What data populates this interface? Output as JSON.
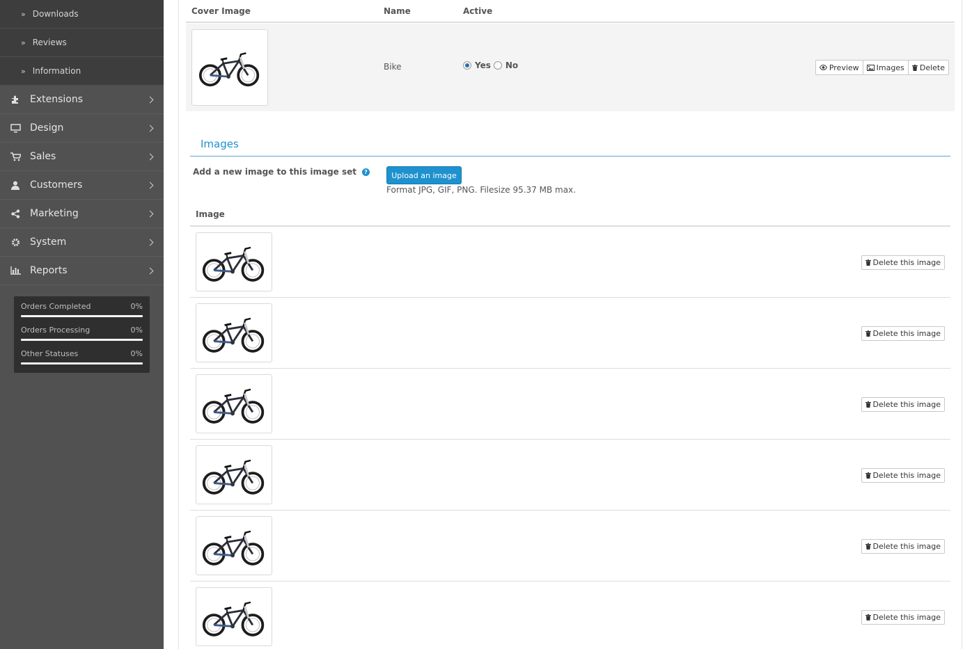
{
  "sidebar": {
    "sub_items": [
      {
        "label": "Downloads"
      },
      {
        "label": "Reviews"
      },
      {
        "label": "Information"
      }
    ],
    "menu": [
      {
        "label": "Extensions",
        "icon": "puzzle-icon"
      },
      {
        "label": "Design",
        "icon": "monitor-icon"
      },
      {
        "label": "Sales",
        "icon": "cart-icon"
      },
      {
        "label": "Customers",
        "icon": "user-icon"
      },
      {
        "label": "Marketing",
        "icon": "share-icon"
      },
      {
        "label": "System",
        "icon": "gear-icon"
      },
      {
        "label": "Reports",
        "icon": "bar-chart-icon"
      }
    ],
    "stats": [
      {
        "label": "Orders Completed",
        "value": "0%",
        "progress": 0
      },
      {
        "label": "Orders Processing",
        "value": "0%",
        "progress": 0
      },
      {
        "label": "Other Statuses",
        "value": "0%",
        "progress": 0
      }
    ]
  },
  "table": {
    "headers": {
      "cover": "Cover Image",
      "name": "Name",
      "active": "Active"
    },
    "row": {
      "name": "Bike",
      "active_yes": "Yes",
      "active_no": "No",
      "active_selected": "Yes",
      "preview_label": "Preview",
      "images_label": "Images",
      "delete_label": "Delete"
    }
  },
  "images_section": {
    "title": "Images",
    "add_label": "Add a new image to this image set",
    "upload_label": "Upload an image",
    "format_text": "Format JPG, GIF, PNG. Filesize 95.37 MB max.",
    "column_header": "Image",
    "delete_image_label": "Delete this image",
    "image_count": 6
  },
  "colors": {
    "accent": "#1e91cf",
    "sidebar_bg": "#515151",
    "submenu_bg": "#3d3d3d",
    "stats_bg": "#2f2f2f"
  }
}
